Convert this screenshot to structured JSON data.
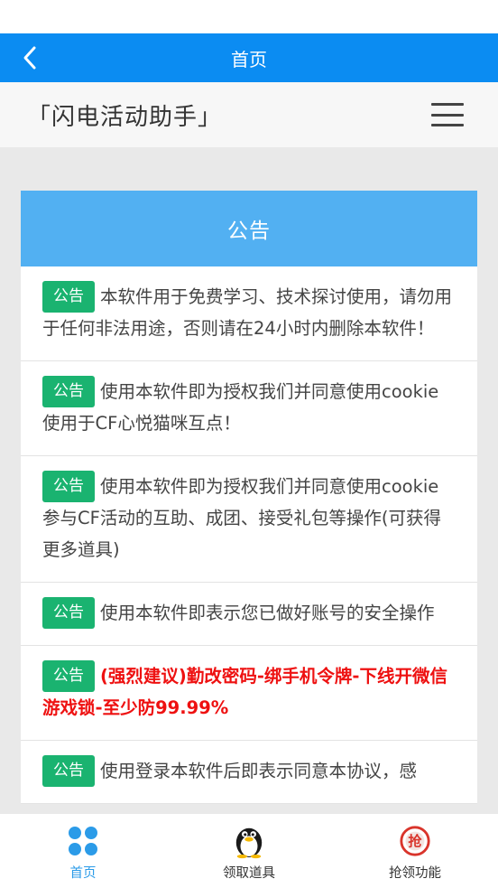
{
  "nav": {
    "title": "首页"
  },
  "brand": {
    "title": "「闪电活动助手」"
  },
  "panel": {
    "title": "公告"
  },
  "notices": [
    {
      "tag": "公告",
      "text": "本软件用于免费学习、技术探讨使用，请勿用于任何非法用途，否则请在24小时内删除本软件！"
    },
    {
      "tag": "公告",
      "text": "使用本软件即为授权我们并同意使用cookie使用于CF心悦猫咪互点！"
    },
    {
      "tag": "公告",
      "text": "使用本软件即为授权我们并同意使用cookie参与CF活动的互助、成团、接受礼包等操作(可获得更多道具)"
    },
    {
      "tag": "公告",
      "text": "使用本软件即表示您已做好账号的安全操作"
    },
    {
      "tag": "公告",
      "text": "(强烈建议)勤改密码-绑手机令牌-下线开微信游戏锁-至少防99.99%"
    },
    {
      "tag": "公告",
      "text": "使用登录本软件后即表示同意本协议，感"
    }
  ],
  "tabs": [
    {
      "label": "首页",
      "icon": "grid-dots-icon"
    },
    {
      "label": "领取道具",
      "icon": "penguin-icon"
    },
    {
      "label": "抢领功能",
      "icon": "grab-badge-icon"
    }
  ],
  "colors": {
    "primary": "#0b8cf2",
    "panel": "#52b0f2",
    "tag": "#1ab370",
    "alert": "#ee1111"
  }
}
